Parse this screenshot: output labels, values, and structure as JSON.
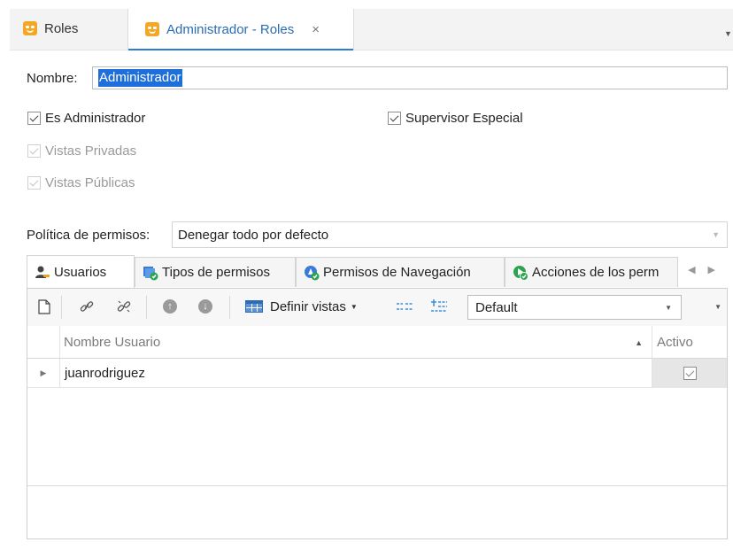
{
  "doc_tabs": [
    {
      "label": "Roles",
      "icon": "theater-mask-icon",
      "active": false
    },
    {
      "label": "Administrador - Roles",
      "icon": "theater-mask-icon",
      "active": true,
      "close": "×"
    }
  ],
  "form": {
    "nombre_label": "Nombre:",
    "nombre_value": "Administrador",
    "checkboxes": [
      {
        "label": "Es Administrador",
        "checked": true,
        "enabled": true
      },
      {
        "label": "Supervisor Especial",
        "checked": true,
        "enabled": true
      },
      {
        "label": "Vistas Privadas",
        "checked": true,
        "enabled": false
      },
      {
        "label": "Vistas Públicas",
        "checked": true,
        "enabled": false
      }
    ],
    "politica_label": "Política de permisos:",
    "politica_value": "Denegar todo por defecto"
  },
  "inner_tabs": [
    {
      "label": "Usuarios",
      "icon": "user-key-icon",
      "active": true
    },
    {
      "label": "Tipos de permisos",
      "icon": "permission-types-icon",
      "active": false
    },
    {
      "label": "Permisos de Navegación",
      "icon": "navigation-permission-icon",
      "active": false
    },
    {
      "label": "Acciones de los perm",
      "icon": "actions-permission-icon",
      "active": false
    }
  ],
  "toolbar": {
    "definir_vistas_label": "Definir vistas",
    "layout_value": "Default"
  },
  "grid": {
    "columns": [
      "Nombre Usuario",
      "Activo"
    ],
    "rows": [
      {
        "nombre": "juanrodriguez",
        "activo": true
      }
    ]
  },
  "colors": {
    "accent": "#2e7bd6",
    "selection": "#1e6fd9",
    "mask_icon": "#f5a623"
  }
}
